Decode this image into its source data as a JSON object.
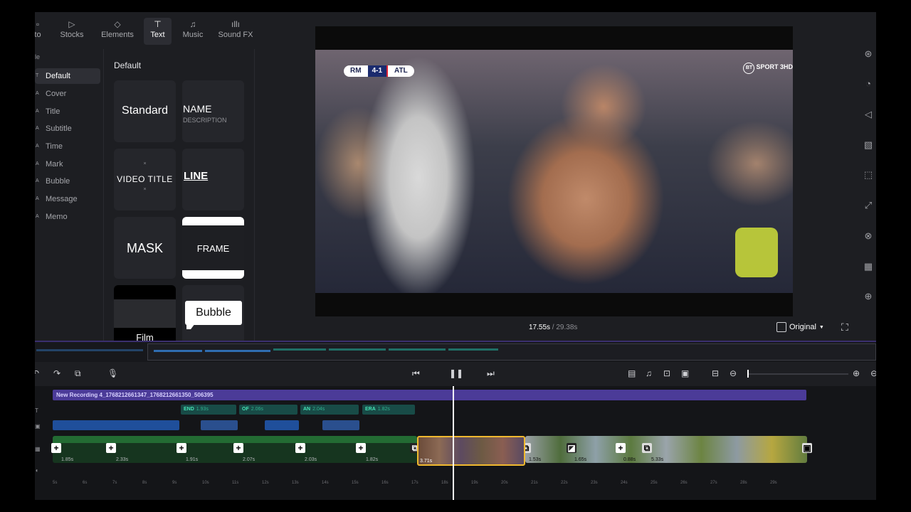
{
  "tabs": [
    {
      "label": "to",
      "icon": "photo-icon"
    },
    {
      "label": "Stocks",
      "icon": "play-square-icon"
    },
    {
      "label": "Elements",
      "icon": "shapes-icon"
    },
    {
      "label": "Text",
      "icon": "text-icon"
    },
    {
      "label": "Music",
      "icon": "music-note-icon"
    },
    {
      "label": "Sound FX",
      "icon": "waveform-icon"
    }
  ],
  "sidebar": {
    "heading": "le",
    "items": [
      "Default",
      "Cover",
      "Title",
      "Subtitle",
      "Time",
      "Mark",
      "Bubble",
      "Message",
      "Memo"
    ]
  },
  "panel": {
    "title": "Default",
    "cards": {
      "standard": "Standard",
      "name": "NAME",
      "description": "DESCRIPTION",
      "video_title": "VIDEO TITLE",
      "line": "LINE",
      "mask": "MASK",
      "frame": "FRAME",
      "film": "Film",
      "bubble": "Bubble"
    }
  },
  "preview": {
    "score_home": "RM",
    "score": "4-1",
    "score_away": "ATL",
    "broadcaster": "SPORT 3HD",
    "broadcaster_logo": "BT",
    "current_time": "17.55s",
    "total_time": " / 29.38s",
    "aspect": "Original"
  },
  "timeline": {
    "audio_clip": "New Recording 4_1768212661347_1768212661350_506395",
    "text_clips": [
      {
        "label": "END",
        "dur": "1.93s"
      },
      {
        "label": "OF",
        "dur": "2.06s"
      },
      {
        "label": "AN",
        "dur": "2.04s"
      },
      {
        "label": "ERA",
        "dur": "1.82s"
      }
    ],
    "video_durations": [
      "1.85s",
      "2.33s",
      "1.91s",
      "2.07s",
      "2.03s",
      "1.82s",
      "3.71s",
      "1.53s",
      "1.65s",
      "0.88s",
      "5.33s"
    ],
    "ruler": [
      "5s",
      "6s",
      "7s",
      "8s",
      "9s",
      "10s",
      "11s",
      "12s",
      "13s",
      "14s",
      "15s",
      "16s",
      "17s",
      "18s",
      "19s",
      "20s",
      "21s",
      "22s",
      "23s",
      "24s",
      "25s",
      "26s",
      "27s",
      "28s",
      "29s"
    ]
  },
  "colors": {
    "accent_purple": "#4b3b98",
    "text_clip": "#184b47",
    "selection": "#f0b92f"
  }
}
